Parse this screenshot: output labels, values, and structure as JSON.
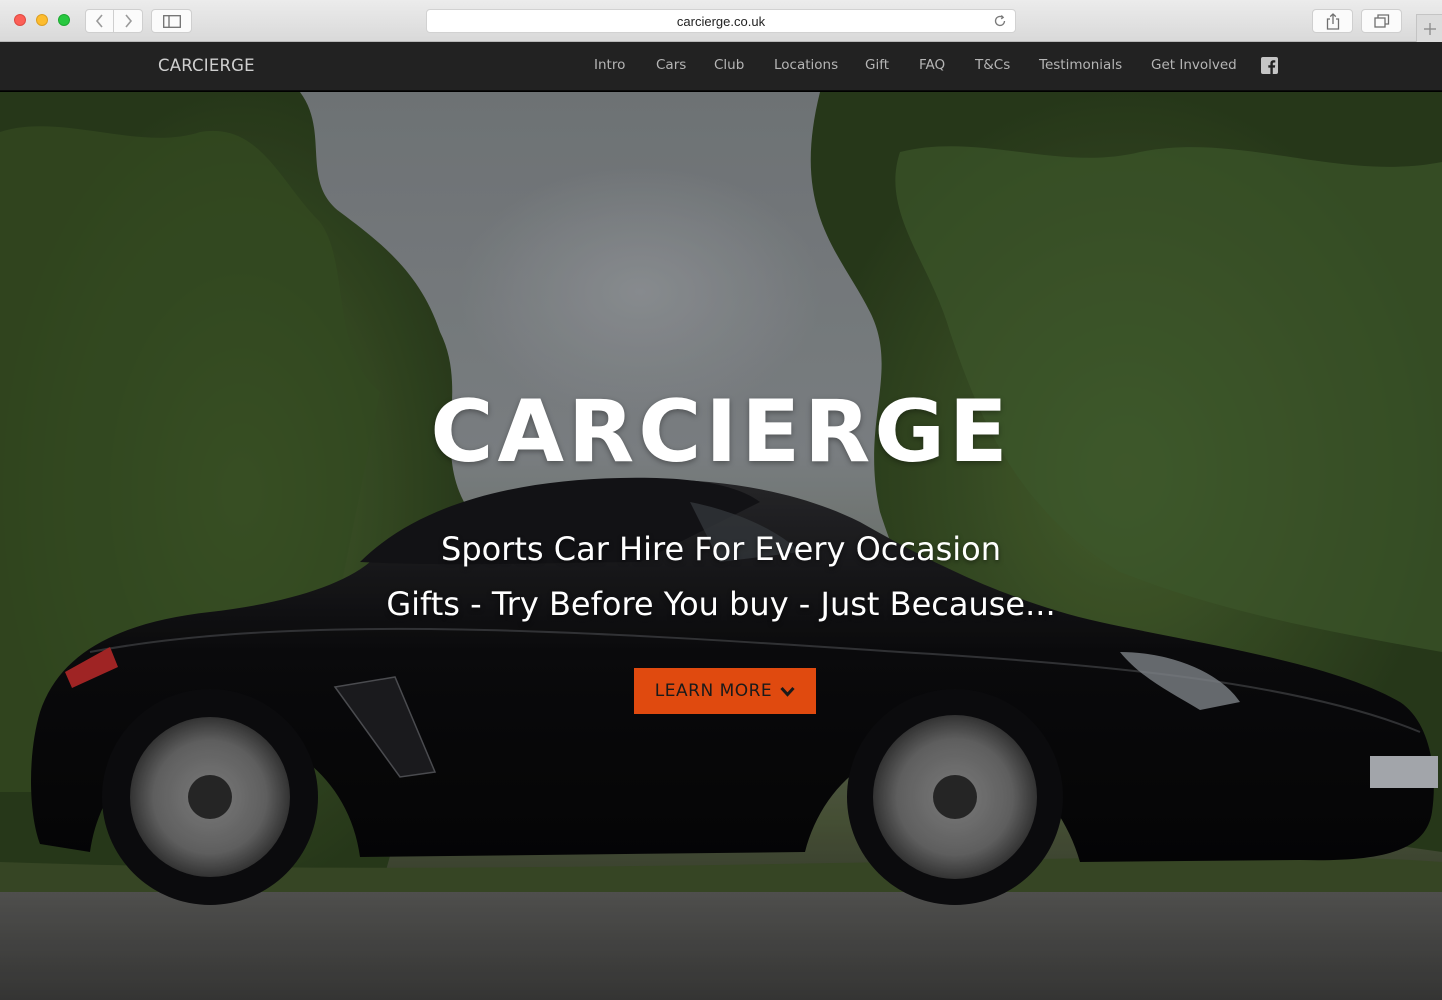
{
  "browser": {
    "url": "carcierge.co.uk",
    "icons": {
      "back": "chevron-left-icon",
      "forward": "chevron-right-icon",
      "sidebar": "sidebar-icon",
      "reload": "reload-icon",
      "share": "share-icon",
      "tabs": "tabs-overview-icon",
      "new_tab": "plus-icon"
    }
  },
  "nav": {
    "brand": "CARCIERGE",
    "links": [
      {
        "label": "Intro"
      },
      {
        "label": "Cars"
      },
      {
        "label": "Club"
      },
      {
        "label": "Locations"
      },
      {
        "label": "Gift"
      },
      {
        "label": "FAQ"
      },
      {
        "label": "T&Cs"
      },
      {
        "label": "Testimonials"
      },
      {
        "label": "Get Involved"
      }
    ],
    "social_icon": "facebook-icon"
  },
  "hero": {
    "title": "CARCIERGE",
    "subtitle_1": "Sports Car Hire For Every Occasion",
    "subtitle_2": "Gifts - Try Before You buy - Just Because...",
    "cta_label": "LEARN MORE",
    "cta_icon": "chevron-down-icon"
  },
  "colors": {
    "nav_bg": "#222222",
    "accent": "#e04a0f",
    "brand_text": "#cfcfcf"
  }
}
